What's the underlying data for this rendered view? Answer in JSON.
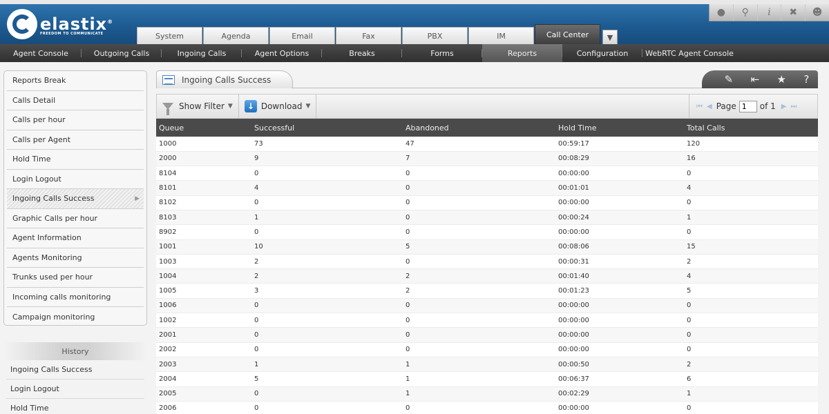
{
  "brand": {
    "name": "elastix",
    "reg": "®",
    "tagline": "FREEDOM TO COMMUNICATE"
  },
  "main_tabs": [
    {
      "label": "System"
    },
    {
      "label": "Agenda"
    },
    {
      "label": "Email"
    },
    {
      "label": "Fax"
    },
    {
      "label": "PBX"
    },
    {
      "label": "IM"
    },
    {
      "label": "Call Center",
      "active": true
    }
  ],
  "top_icons": [
    "drop-icon",
    "search-icon",
    "info-icon",
    "tools-icon",
    "user-icon"
  ],
  "subnav": [
    {
      "label": "Agent Console"
    },
    {
      "label": "Outgoing Calls"
    },
    {
      "label": "Ingoing Calls"
    },
    {
      "label": "Agent Options"
    },
    {
      "label": "Breaks"
    },
    {
      "label": "Forms"
    },
    {
      "label": "Reports",
      "active": true
    },
    {
      "label": "Configuration"
    },
    {
      "label": "WebRTC Agent Console"
    }
  ],
  "sidebar": {
    "items": [
      {
        "label": "Reports Break"
      },
      {
        "label": "Calls Detail"
      },
      {
        "label": "Calls per hour"
      },
      {
        "label": "Calls per Agent"
      },
      {
        "label": "Hold Time"
      },
      {
        "label": "Login Logout"
      },
      {
        "label": "Ingoing Calls Success",
        "active": true
      },
      {
        "label": "Graphic Calls per hour"
      },
      {
        "label": "Agent Information"
      },
      {
        "label": "Agents Monitoring"
      },
      {
        "label": "Trunks used per hour"
      },
      {
        "label": "Incoming calls monitoring"
      },
      {
        "label": "Campaign monitoring"
      }
    ]
  },
  "history": {
    "title": "History",
    "items": [
      {
        "label": "Ingoing Calls Success"
      },
      {
        "label": "Login Logout"
      },
      {
        "label": "Hold Time"
      }
    ]
  },
  "content": {
    "title": "Ingoing Calls Success",
    "toolbar": {
      "show_filter": "Show Filter",
      "download": "Download"
    },
    "pager": {
      "page_label": "Page",
      "page_value": "1",
      "of_label": "of 1"
    },
    "columns": [
      "Queue",
      "Successful",
      "Abandoned",
      "Hold Time",
      "Total Calls"
    ],
    "rows": [
      [
        "1000",
        "73",
        "47",
        "00:59:17",
        "120"
      ],
      [
        "2000",
        "9",
        "7",
        "00:08:29",
        "16"
      ],
      [
        "8104",
        "0",
        "0",
        "00:00:00",
        "0"
      ],
      [
        "8101",
        "4",
        "0",
        "00:01:01",
        "4"
      ],
      [
        "8102",
        "0",
        "0",
        "00:00:00",
        "0"
      ],
      [
        "8103",
        "1",
        "0",
        "00:00:24",
        "1"
      ],
      [
        "8902",
        "0",
        "0",
        "00:00:00",
        "0"
      ],
      [
        "1001",
        "10",
        "5",
        "00:08:06",
        "15"
      ],
      [
        "1003",
        "2",
        "0",
        "00:00:31",
        "2"
      ],
      [
        "1004",
        "2",
        "2",
        "00:01:40",
        "4"
      ],
      [
        "1005",
        "3",
        "2",
        "00:01:23",
        "5"
      ],
      [
        "1006",
        "0",
        "0",
        "00:00:00",
        "0"
      ],
      [
        "1002",
        "0",
        "0",
        "00:00:00",
        "0"
      ],
      [
        "2001",
        "0",
        "0",
        "00:00:00",
        "0"
      ],
      [
        "2002",
        "0",
        "0",
        "00:00:00",
        "0"
      ],
      [
        "2003",
        "1",
        "1",
        "00:00:50",
        "2"
      ],
      [
        "2004",
        "5",
        "1",
        "00:06:37",
        "6"
      ],
      [
        "2005",
        "0",
        "1",
        "00:02:29",
        "1"
      ],
      [
        "2006",
        "0",
        "0",
        "00:00:00",
        "0"
      ]
    ]
  },
  "colors": {
    "header_blue": "#1d5a91",
    "nav_dark": "#3a3a3a",
    "table_head": "#4a4a4a"
  }
}
